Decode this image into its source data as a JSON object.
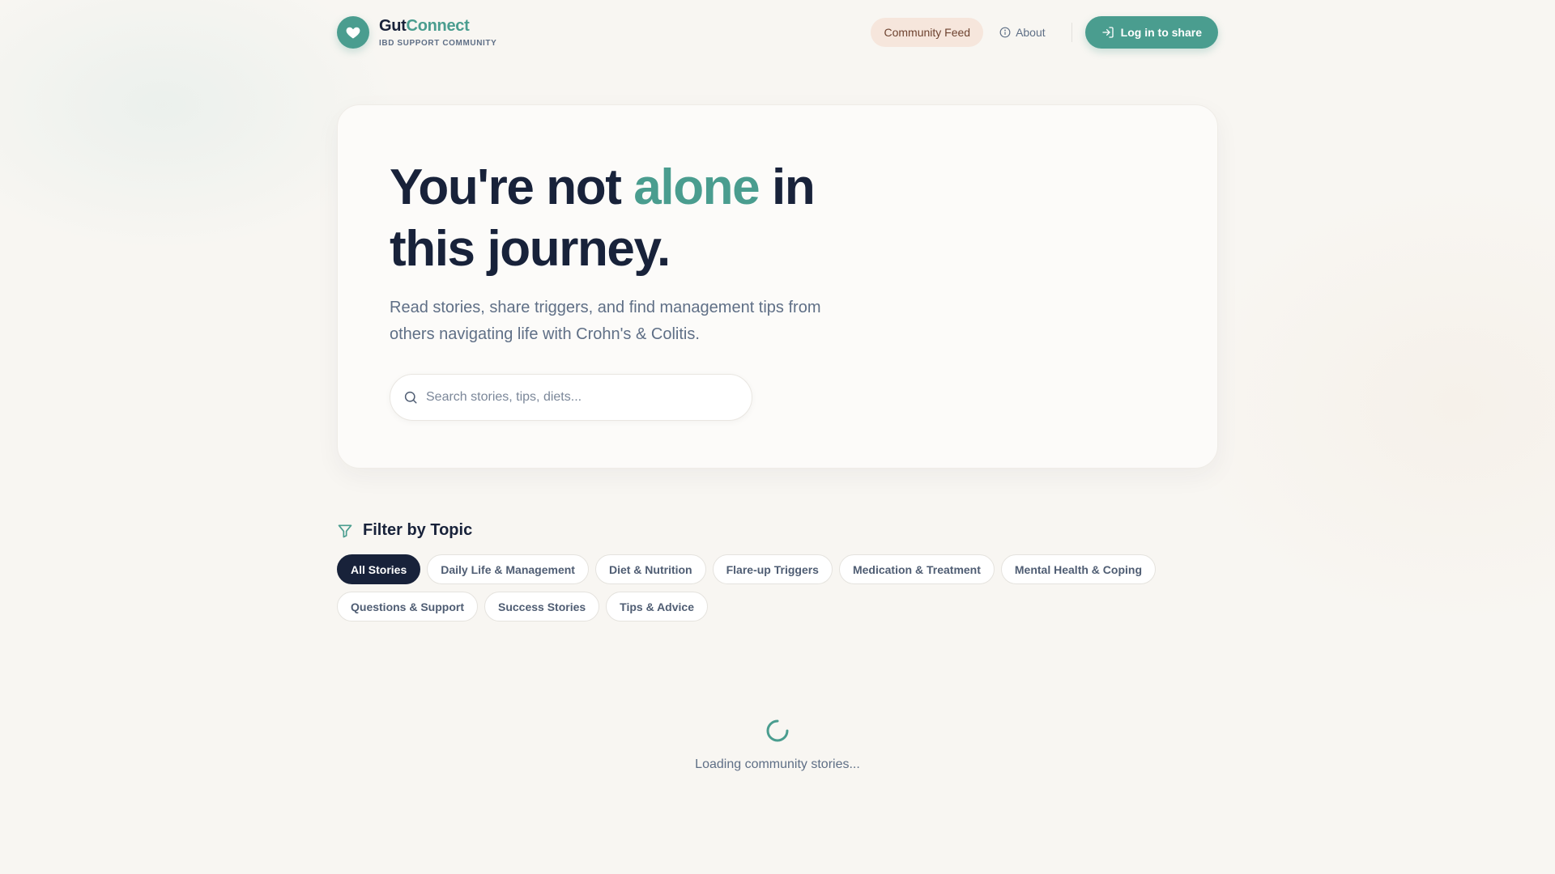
{
  "header": {
    "brand_prefix": "Gut",
    "brand_accent": "Connect",
    "brand_sub": "IBD SUPPORT COMMUNITY",
    "nav_feed": "Community Feed",
    "nav_about": "About",
    "login": "Log in to share"
  },
  "hero": {
    "title_pre": "You're not ",
    "title_accent": "alone",
    "title_post": " in this journey.",
    "description": "Read stories, share triggers, and find management tips from others navigating life with Crohn's & Colitis.",
    "search_placeholder": "Search stories, tips, diets..."
  },
  "filter": {
    "title": "Filter by Topic",
    "chips": [
      "All Stories",
      "Daily Life & Management",
      "Diet & Nutrition",
      "Flare-up Triggers",
      "Medication & Treatment",
      "Mental Health & Coping",
      "Questions & Support",
      "Success Stories",
      "Tips & Advice"
    ],
    "active_index": 0
  },
  "loading": {
    "text": "Loading community stories..."
  },
  "colors": {
    "accent": "#4a9d8f",
    "dark": "#18223a",
    "muted": "#5f6f86",
    "feed_bg": "#f6e6dc"
  },
  "icons": {
    "logo": "heart-icon",
    "about": "info-icon",
    "login": "login-icon",
    "search": "search-icon",
    "filter": "filter-icon",
    "loading": "spinner-icon"
  }
}
